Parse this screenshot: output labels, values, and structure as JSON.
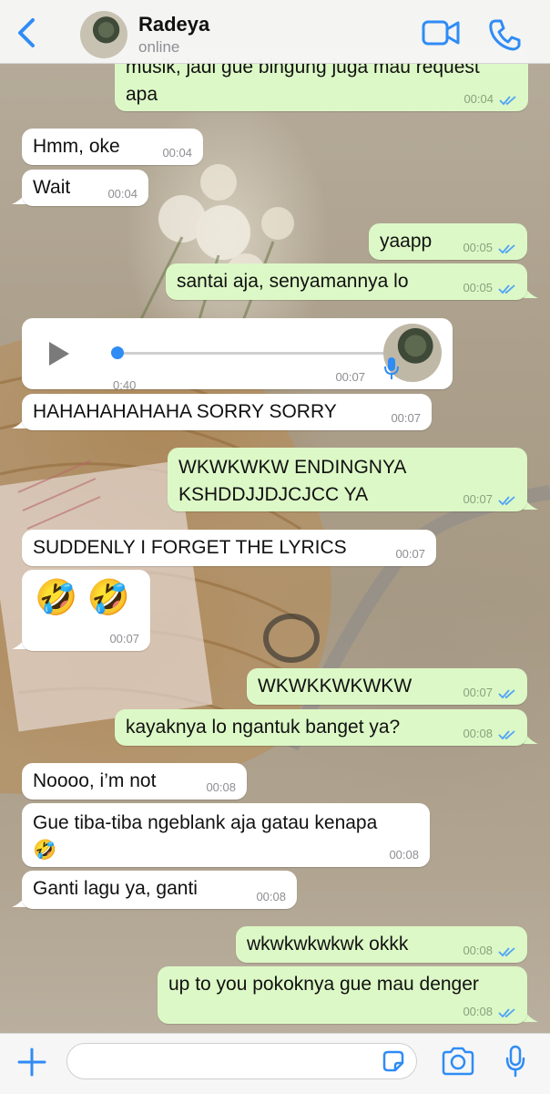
{
  "header": {
    "contact_name": "Radeya",
    "status": "online"
  },
  "colors": {
    "accent": "#2f8cf5",
    "outgoing_bubble": "#dcf8c6",
    "incoming_bubble": "#ffffff",
    "read_ticks": "#4fa3f7"
  },
  "messages": [
    {
      "direction": "out",
      "text": "musik, jadi gue bingung juga mau request",
      "text2": "apa",
      "time": "00:04",
      "read": true
    },
    {
      "direction": "in",
      "text": "Hmm, oke",
      "time": "00:04"
    },
    {
      "direction": "in",
      "text": "Wait",
      "time": "00:04"
    },
    {
      "direction": "out",
      "text": "yaapp",
      "time": "00:05",
      "read": true
    },
    {
      "direction": "out",
      "text": "santai aja, senyamannya lo",
      "time": "00:05",
      "read": true
    },
    {
      "direction": "in",
      "type": "voice",
      "duration": "0:40",
      "time": "00:07"
    },
    {
      "direction": "in",
      "text": "HAHAHAHAHAHA SORRY SORRY",
      "time": "00:07"
    },
    {
      "direction": "out",
      "text": "WKWKWKW ENDINGNYA",
      "text2": "KSHDDJJDJCJCC YA",
      "time": "00:07",
      "read": true
    },
    {
      "direction": "in",
      "text": "SUDDENLY I FORGET THE LYRICS",
      "time": "00:07"
    },
    {
      "direction": "in",
      "text": "🤣 🤣",
      "time": "00:07"
    },
    {
      "direction": "out",
      "text": "WKWKKWKWKW",
      "time": "00:07",
      "read": true
    },
    {
      "direction": "out",
      "text": "kayaknya lo ngantuk banget ya?",
      "time": "00:08",
      "read": true
    },
    {
      "direction": "in",
      "text": "Noooo, i’m not",
      "time": "00:08"
    },
    {
      "direction": "in",
      "text": "Gue tiba-tiba ngeblank aja gatau kenapa",
      "text2": "🤣",
      "time": "00:08"
    },
    {
      "direction": "in",
      "text": "Ganti lagu ya, ganti",
      "time": "00:08"
    },
    {
      "direction": "out",
      "text": "wkwkwkwkwk okkk",
      "time": "00:08",
      "read": true
    },
    {
      "direction": "out",
      "text": "up to you pokoknya gue mau denger",
      "time": "00:08",
      "read": true
    }
  ],
  "input": {
    "value": "",
    "placeholder": ""
  }
}
